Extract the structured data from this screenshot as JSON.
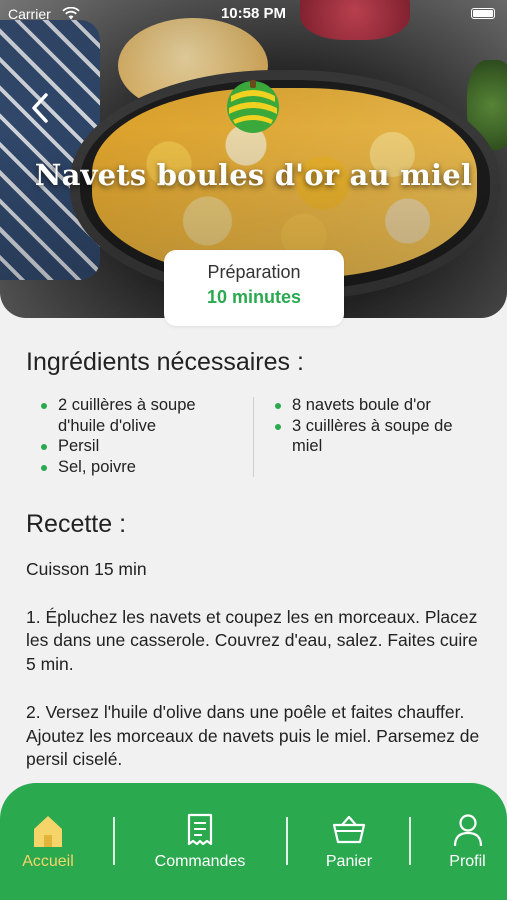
{
  "status_bar": {
    "carrier": "Carrier",
    "time": "10:58 PM"
  },
  "recipe": {
    "title": "Navets boules d'or au miel",
    "preparation_label": "Préparation",
    "preparation_value": "10 minutes"
  },
  "ingredients": {
    "heading": "Ingrédients nécessaires :",
    "left": [
      "2 cuillères à soupe d'huile d'olive",
      "Persil",
      "Sel, poivre"
    ],
    "right": [
      "8 navets boule d'or",
      "3 cuillères à soupe de miel"
    ]
  },
  "instructions": {
    "heading": "Recette :",
    "text": "Cuisson 15 min\n\n1. Épluchez les navets et coupez les en morceaux. Placez les dans une casserole. Couvrez d'eau, salez. Faites cuire 5 min.\n\n2. Versez l'huile d'olive dans une poêle et faites chauffer. Ajoutez les morceaux de navets puis le miel. Parsemez de persil ciselé."
  },
  "tabbar": {
    "items": [
      {
        "label": "Accueil",
        "icon": "home-icon",
        "active": true
      },
      {
        "label": "Commandes",
        "icon": "receipt-icon",
        "active": false
      },
      {
        "label": "Panier",
        "icon": "basket-icon",
        "active": false
      },
      {
        "label": "Profil",
        "icon": "user-icon",
        "active": false
      }
    ]
  },
  "colors": {
    "accent": "#2aa94f",
    "active_tab": "#f5d46a",
    "background": "#f1f1f1"
  }
}
